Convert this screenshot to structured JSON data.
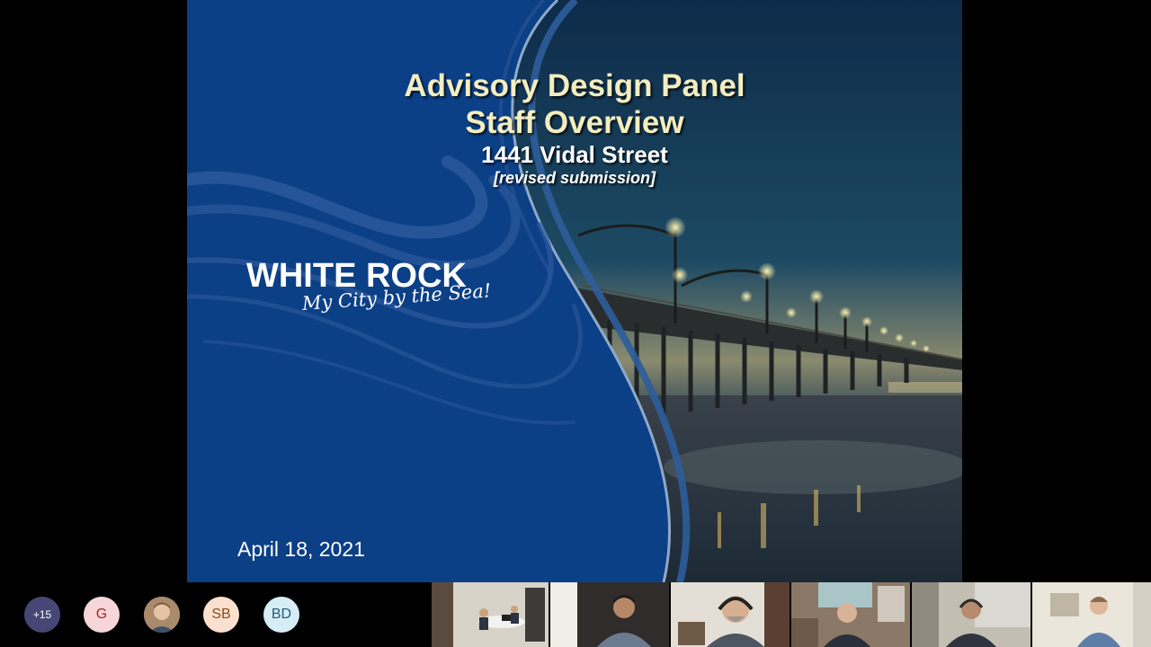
{
  "slide": {
    "title_line1": "Advisory Design Panel",
    "title_line2": "Staff Overview",
    "address": "1441 Vidal Street",
    "subnote": "[revised submission]",
    "logo_name": "WHITE ROCK",
    "logo_tagline": "My City by the Sea!",
    "date": "April 18, 2021"
  },
  "participants": {
    "overflow_count": "+15",
    "initials": [
      "G",
      "SB",
      "BD"
    ]
  },
  "colors": {
    "slide_blue": "#0b3f86",
    "title_text": "#f3edbf",
    "overflow_avatar": "#464775"
  }
}
